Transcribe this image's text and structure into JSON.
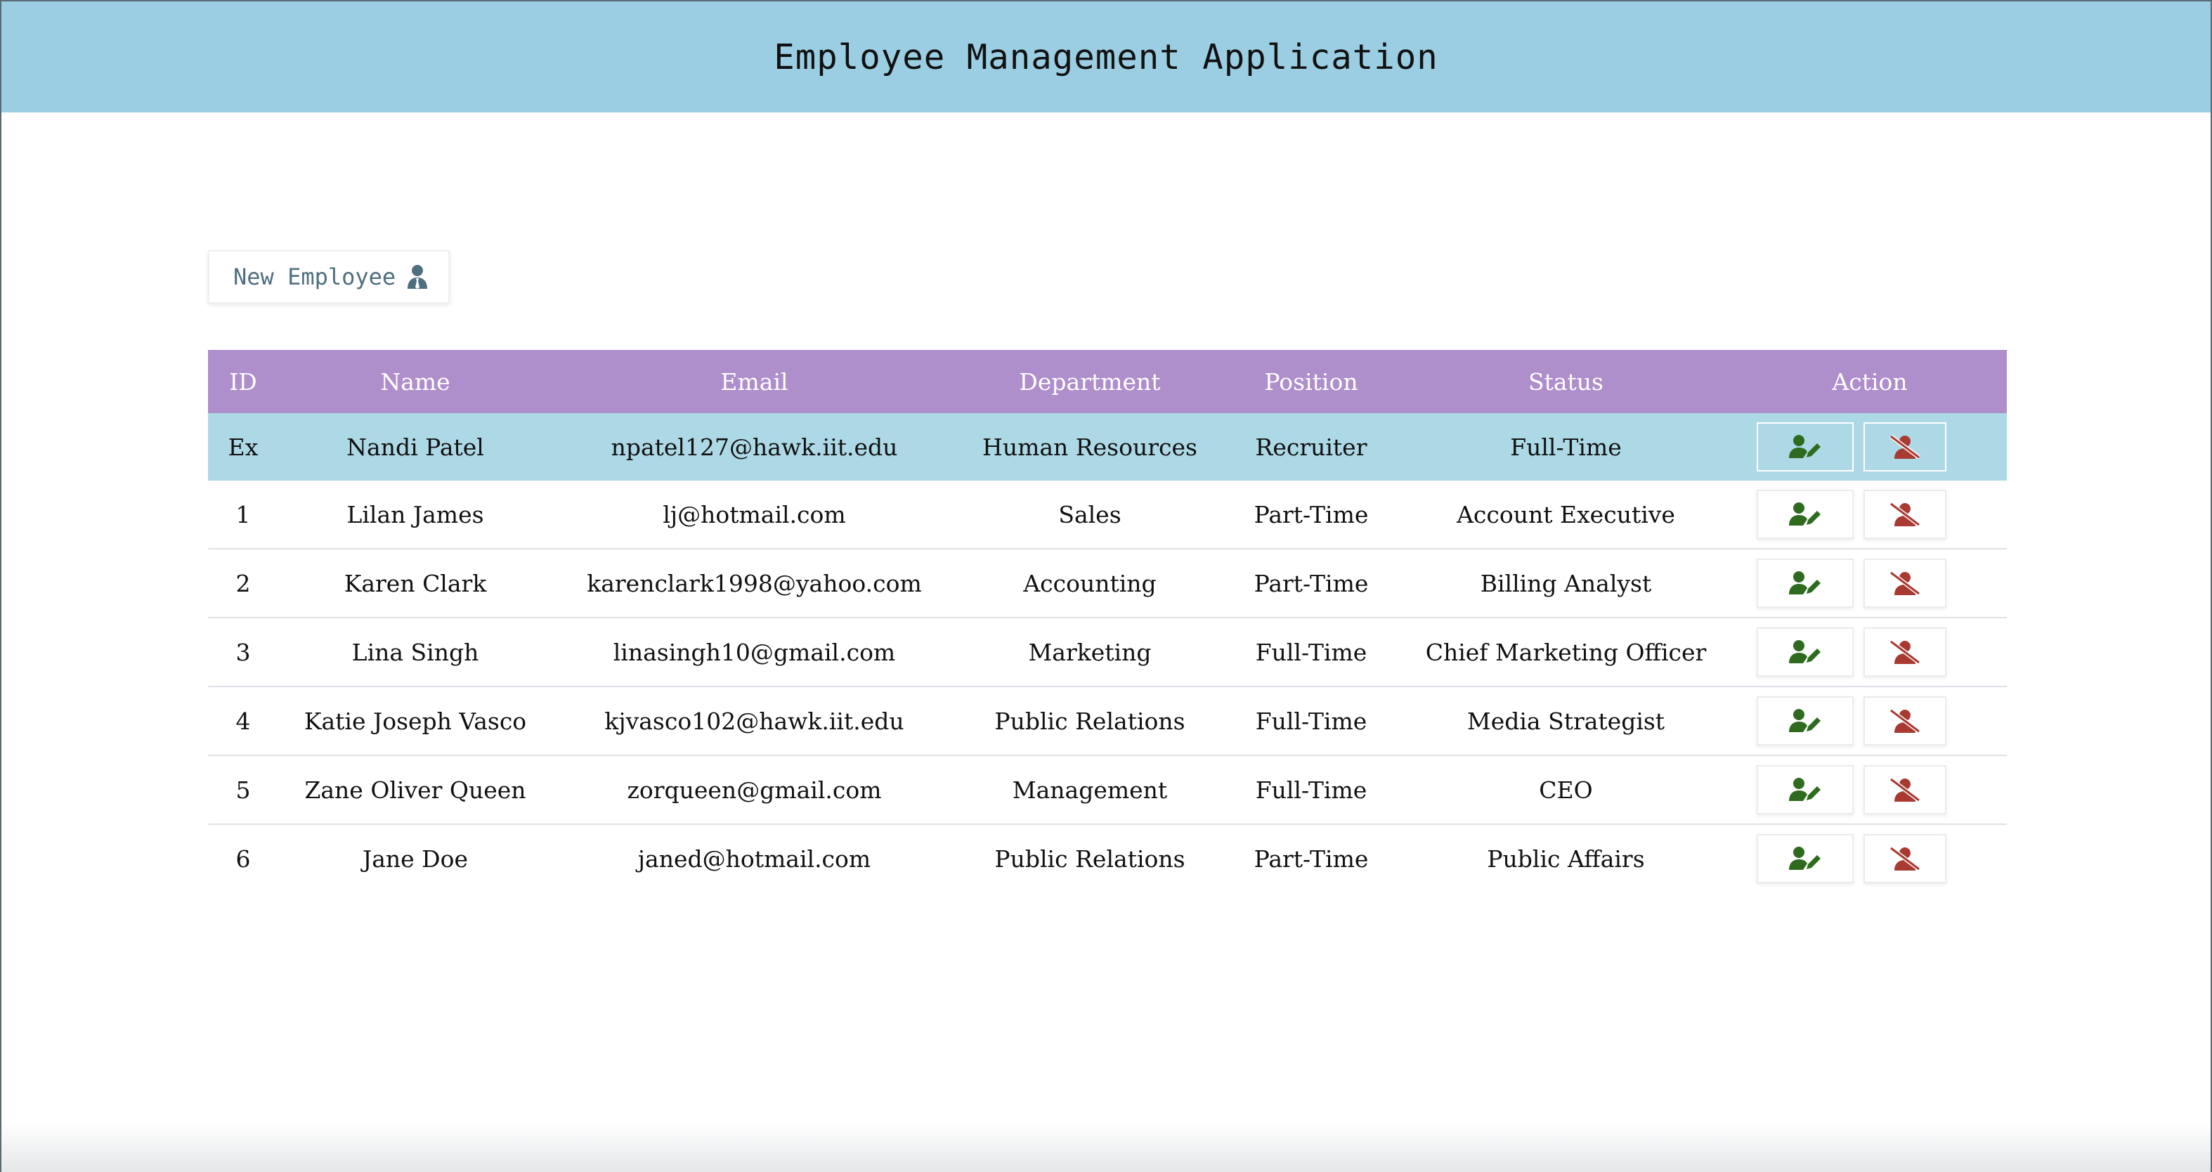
{
  "header": {
    "title": "Employee Management Application"
  },
  "toolbar": {
    "new_employee_label": "New Employee",
    "new_employee_icon": "user-tie-icon"
  },
  "table": {
    "columns": [
      "ID",
      "Name",
      "Email",
      "Department",
      "Position",
      "Status",
      "Action"
    ],
    "rows": [
      {
        "id": "Ex",
        "name": "Nandi Patel",
        "email": "npatel127@hawk.iit.edu",
        "department": "Human Resources",
        "position": "Recruiter",
        "status": "Full-Time",
        "highlighted": true
      },
      {
        "id": "1",
        "name": "Lilan James",
        "email": "lj@hotmail.com",
        "department": "Sales",
        "position": "Part-Time",
        "status": "Account Executive"
      },
      {
        "id": "2",
        "name": "Karen Clark",
        "email": "karenclark1998@yahoo.com",
        "department": "Accounting",
        "position": "Part-Time",
        "status": "Billing Analyst"
      },
      {
        "id": "3",
        "name": "Lina Singh",
        "email": "linasingh10@gmail.com",
        "department": "Marketing",
        "position": "Full-Time",
        "status": "Chief Marketing Officer"
      },
      {
        "id": "4",
        "name": "Katie Joseph Vasco",
        "email": "kjvasco102@hawk.iit.edu",
        "department": "Public Relations",
        "position": "Full-Time",
        "status": "Media Strategist"
      },
      {
        "id": "5",
        "name": "Zane Oliver Queen",
        "email": "zorqueen@gmail.com",
        "department": "Management",
        "position": "Full-Time",
        "status": "CEO"
      },
      {
        "id": "6",
        "name": "Jane Doe",
        "email": "janed@hotmail.com",
        "department": "Public Relations",
        "position": "Part-Time",
        "status": "Public Affairs"
      }
    ],
    "action_icons": {
      "edit": "user-edit-icon",
      "delete": "user-slash-icon"
    }
  },
  "colors": {
    "header_bg": "#9bcee3",
    "table_header_bg": "#ae8ecb",
    "highlight_row_bg": "#add8e6",
    "edit_icon": "#2f6b1f",
    "delete_icon": "#a83a32",
    "new_button_text": "#4f6f7e"
  }
}
